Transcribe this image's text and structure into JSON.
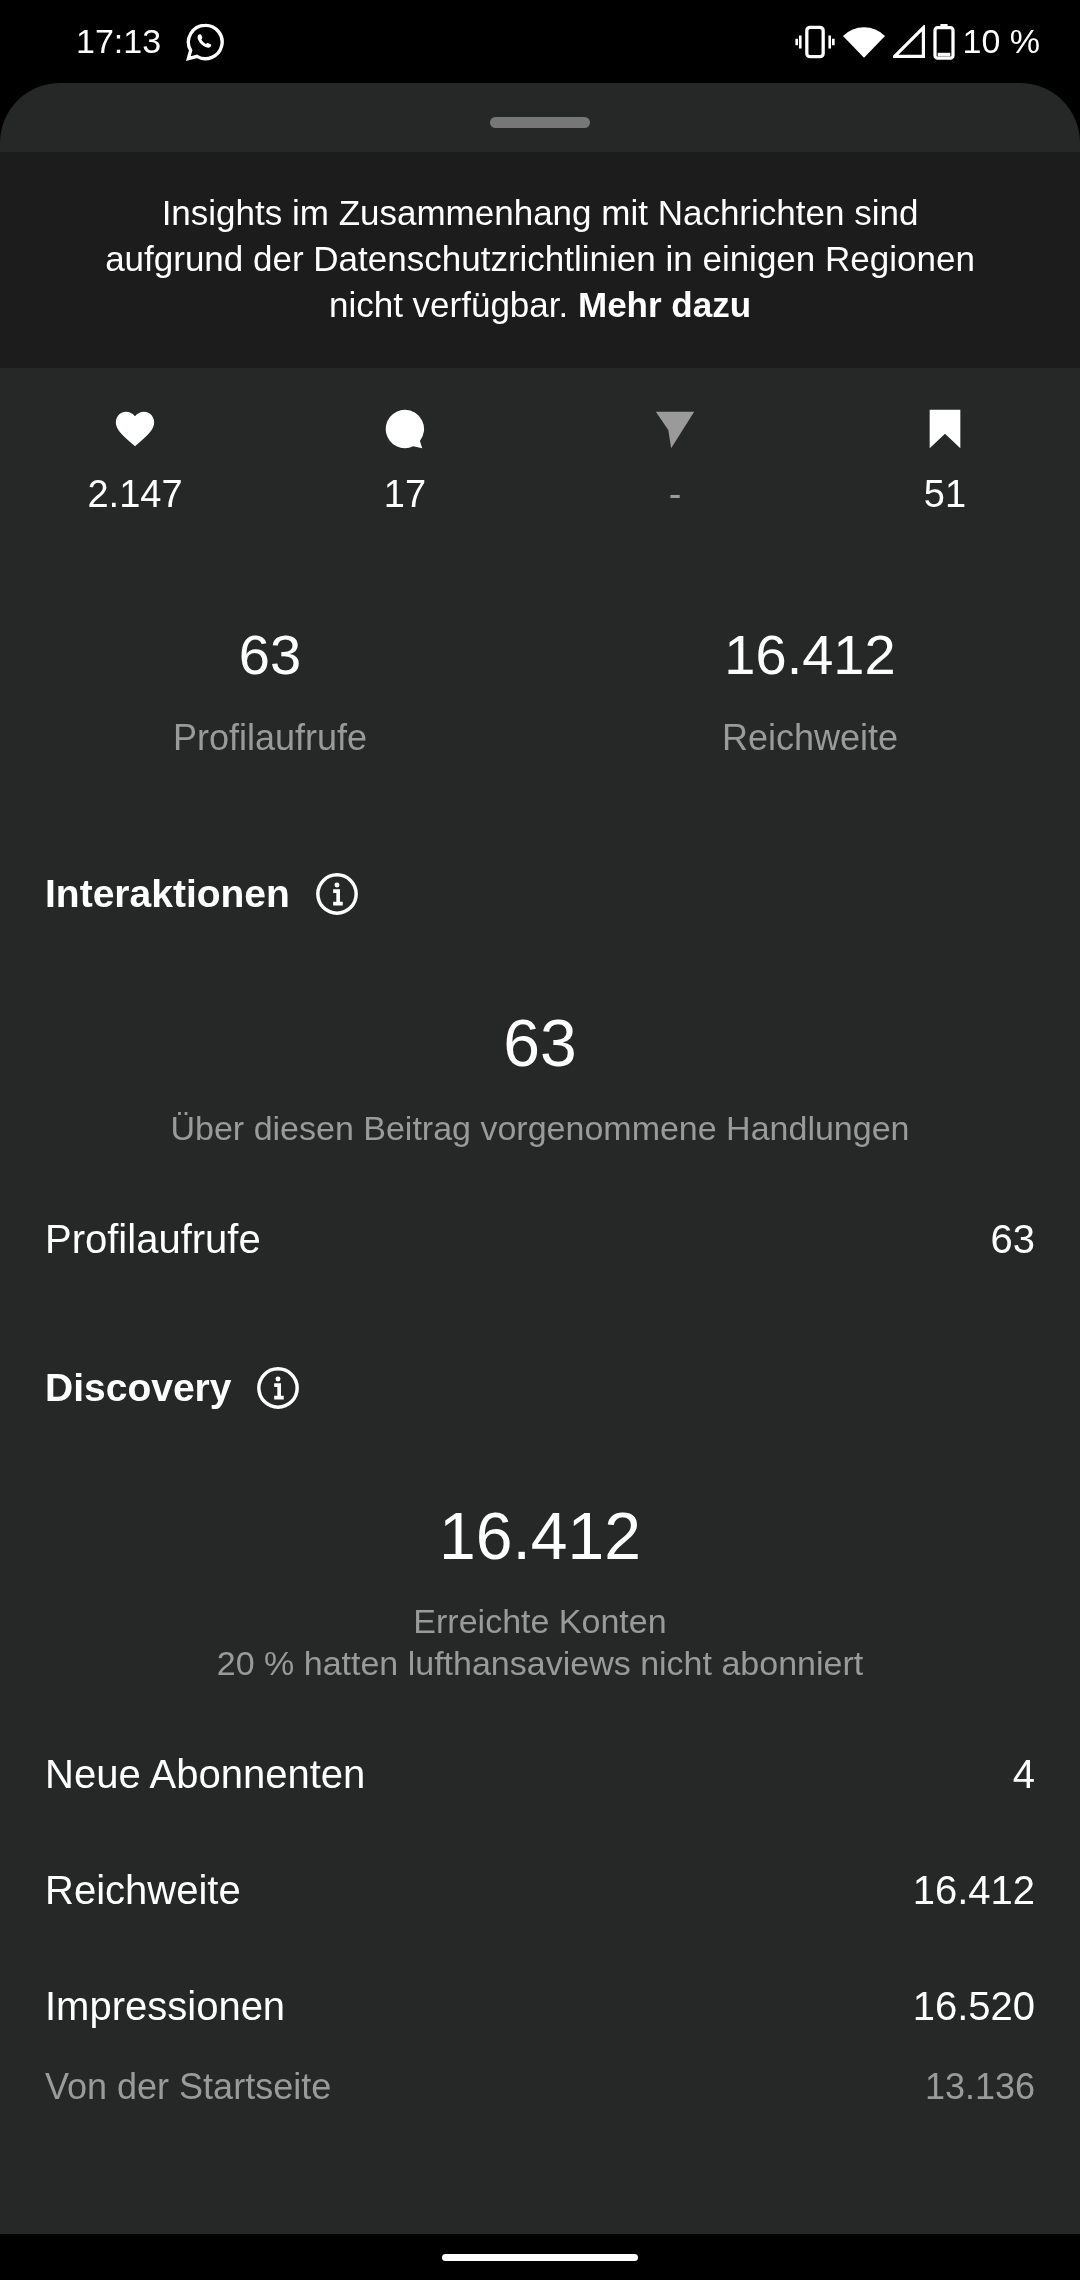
{
  "status_bar": {
    "time": "17:13",
    "battery": "10 %"
  },
  "notice": {
    "text": "Insights im Zusammenhang mit Nachrichten sind aufgrund der Datenschutzrichtlinien in einigen Regionen nicht verfügbar.",
    "link": "Mehr dazu"
  },
  "post_stats": [
    {
      "kind": "likes",
      "value": "2.147",
      "disabled": false
    },
    {
      "kind": "comments",
      "value": "17",
      "disabled": false
    },
    {
      "kind": "shares",
      "value": "-",
      "disabled": true
    },
    {
      "kind": "saves",
      "value": "51",
      "disabled": false
    }
  ],
  "summary": [
    {
      "value": "63",
      "label": "Profilaufrufe"
    },
    {
      "value": "16.412",
      "label": "Reichweite"
    }
  ],
  "sections": [
    {
      "title": "Interaktionen",
      "total": "63",
      "captions": [
        "Über diesen Beitrag vorgenommene Handlungen"
      ],
      "rows": [
        {
          "kind": "main",
          "label": "Profilaufrufe",
          "value": "63"
        }
      ]
    },
    {
      "title": "Discovery",
      "total": "16.412",
      "captions": [
        "Erreichte Konten",
        "20 % hatten lufthansaviews nicht abonniert"
      ],
      "rows": [
        {
          "kind": "main",
          "label": "Neue Abonnenten",
          "value": "4"
        },
        {
          "kind": "main",
          "label": "Reichweite",
          "value": "16.412"
        },
        {
          "kind": "main",
          "label": "Impressionen",
          "value": "16.520"
        },
        {
          "kind": "sub",
          "label": "Von der Startseite",
          "value": "13.136"
        }
      ]
    }
  ]
}
